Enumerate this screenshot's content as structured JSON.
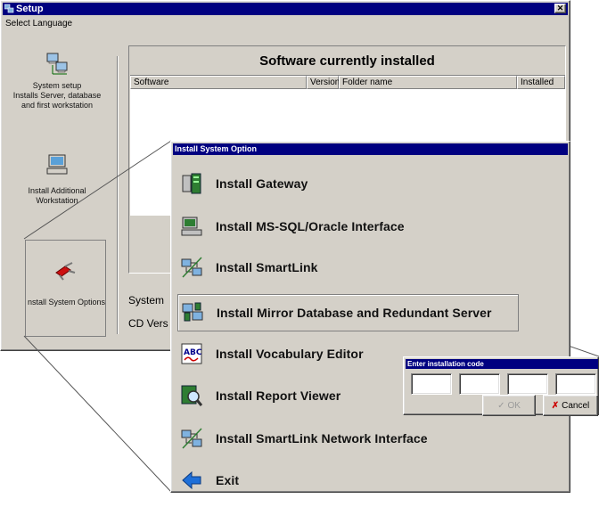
{
  "setup_window": {
    "title": "Setup",
    "menu": {
      "select_language": "Select Language"
    },
    "sidebar": {
      "items": [
        {
          "label": "System setup\nInstalls Server, database\nand first workstation",
          "icon": "network-computers-icon"
        },
        {
          "label": "Install Additional\nWorkstation",
          "icon": "workstation-icon"
        },
        {
          "label": "nstall System Options",
          "icon": "swiss-knife-icon"
        }
      ]
    },
    "software_panel": {
      "heading": "Software currently installed",
      "columns": [
        "Software",
        "Version",
        "Folder name",
        "Installed"
      ]
    },
    "system_label": "System",
    "cd_version_label": "CD Vers"
  },
  "options_dialog": {
    "title": "Install System Option",
    "items": [
      {
        "label": "Install Gateway",
        "icon": "gateway-icon"
      },
      {
        "label": "Install MS-SQL/Oracle Interface",
        "icon": "database-interface-icon"
      },
      {
        "label": "Install SmartLink",
        "icon": "smartlink-icon"
      },
      {
        "label": "Install Mirror Database and Redundant Server",
        "icon": "mirror-server-icon",
        "selected": true
      },
      {
        "label": "Install Vocabulary Editor",
        "icon": "abc-spellcheck-icon"
      },
      {
        "label": "Install Report Viewer",
        "icon": "magnifier-icon"
      },
      {
        "label": "Install SmartLink Network Interface",
        "icon": "network-interface-icon"
      },
      {
        "label": "Exit",
        "icon": "exit-arrow-icon"
      }
    ]
  },
  "code_dialog": {
    "title": "Enter installation code",
    "fields": [
      "",
      "",
      "",
      ""
    ],
    "ok_label": "OK",
    "cancel_label": "Cancel"
  },
  "colors": {
    "title_bar": "#000080",
    "face": "#d4d0c8",
    "cancel_x": "#cc0000"
  }
}
